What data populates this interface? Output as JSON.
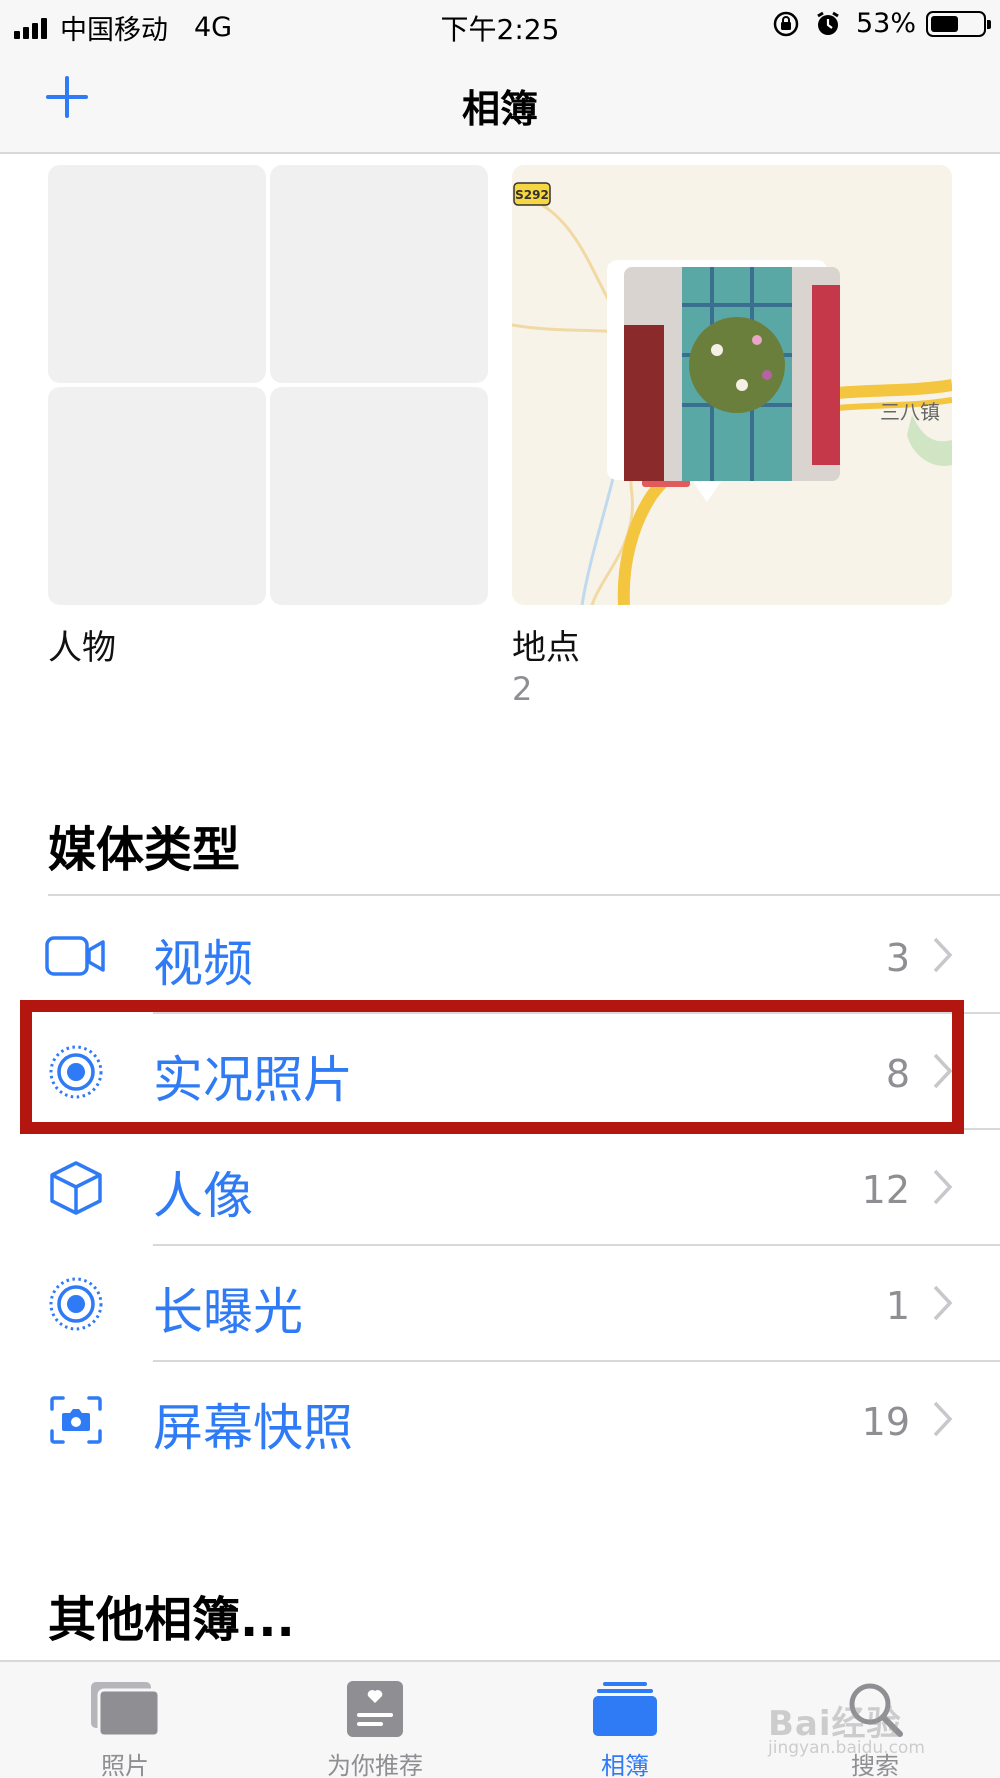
{
  "status_bar": {
    "carrier": "中国移动",
    "network": "4G",
    "time": "下午2:25",
    "battery": "53%",
    "battery_level": 0.53
  },
  "nav": {
    "title": "相簿",
    "add_icon": "plus-icon"
  },
  "albums": {
    "people": {
      "label": "人物"
    },
    "places": {
      "label": "地点",
      "count": "2",
      "map_road_label": "S292",
      "map_town_label": "三八镇"
    }
  },
  "media_types": {
    "title": "媒体类型",
    "items": [
      {
        "label": "视频",
        "count": "3",
        "icon": "video-camera-icon"
      },
      {
        "label": "实况照片",
        "count": "8",
        "icon": "live-photo-icon"
      },
      {
        "label": "人像",
        "count": "12",
        "icon": "cube-icon"
      },
      {
        "label": "长曝光",
        "count": "1",
        "icon": "long-exposure-icon"
      },
      {
        "label": "屏幕快照",
        "count": "19",
        "icon": "screenshot-camera-icon"
      }
    ]
  },
  "other_albums": {
    "title": "其他相簿..."
  },
  "tabs": [
    {
      "label": "照片",
      "icon": "photos-stack-icon",
      "active": false
    },
    {
      "label": "为你推荐",
      "icon": "for-you-heart-icon",
      "active": false
    },
    {
      "label": "相簿",
      "icon": "albums-icon",
      "active": true
    },
    {
      "label": "搜索",
      "icon": "search-icon",
      "active": false
    }
  ],
  "watermark": {
    "text": "Bai经验",
    "url": "jingyan.baidu.com"
  },
  "colors": {
    "accent": "#2f7af5",
    "highlight": "#b3160f",
    "secondary_text": "#8e8e93"
  }
}
